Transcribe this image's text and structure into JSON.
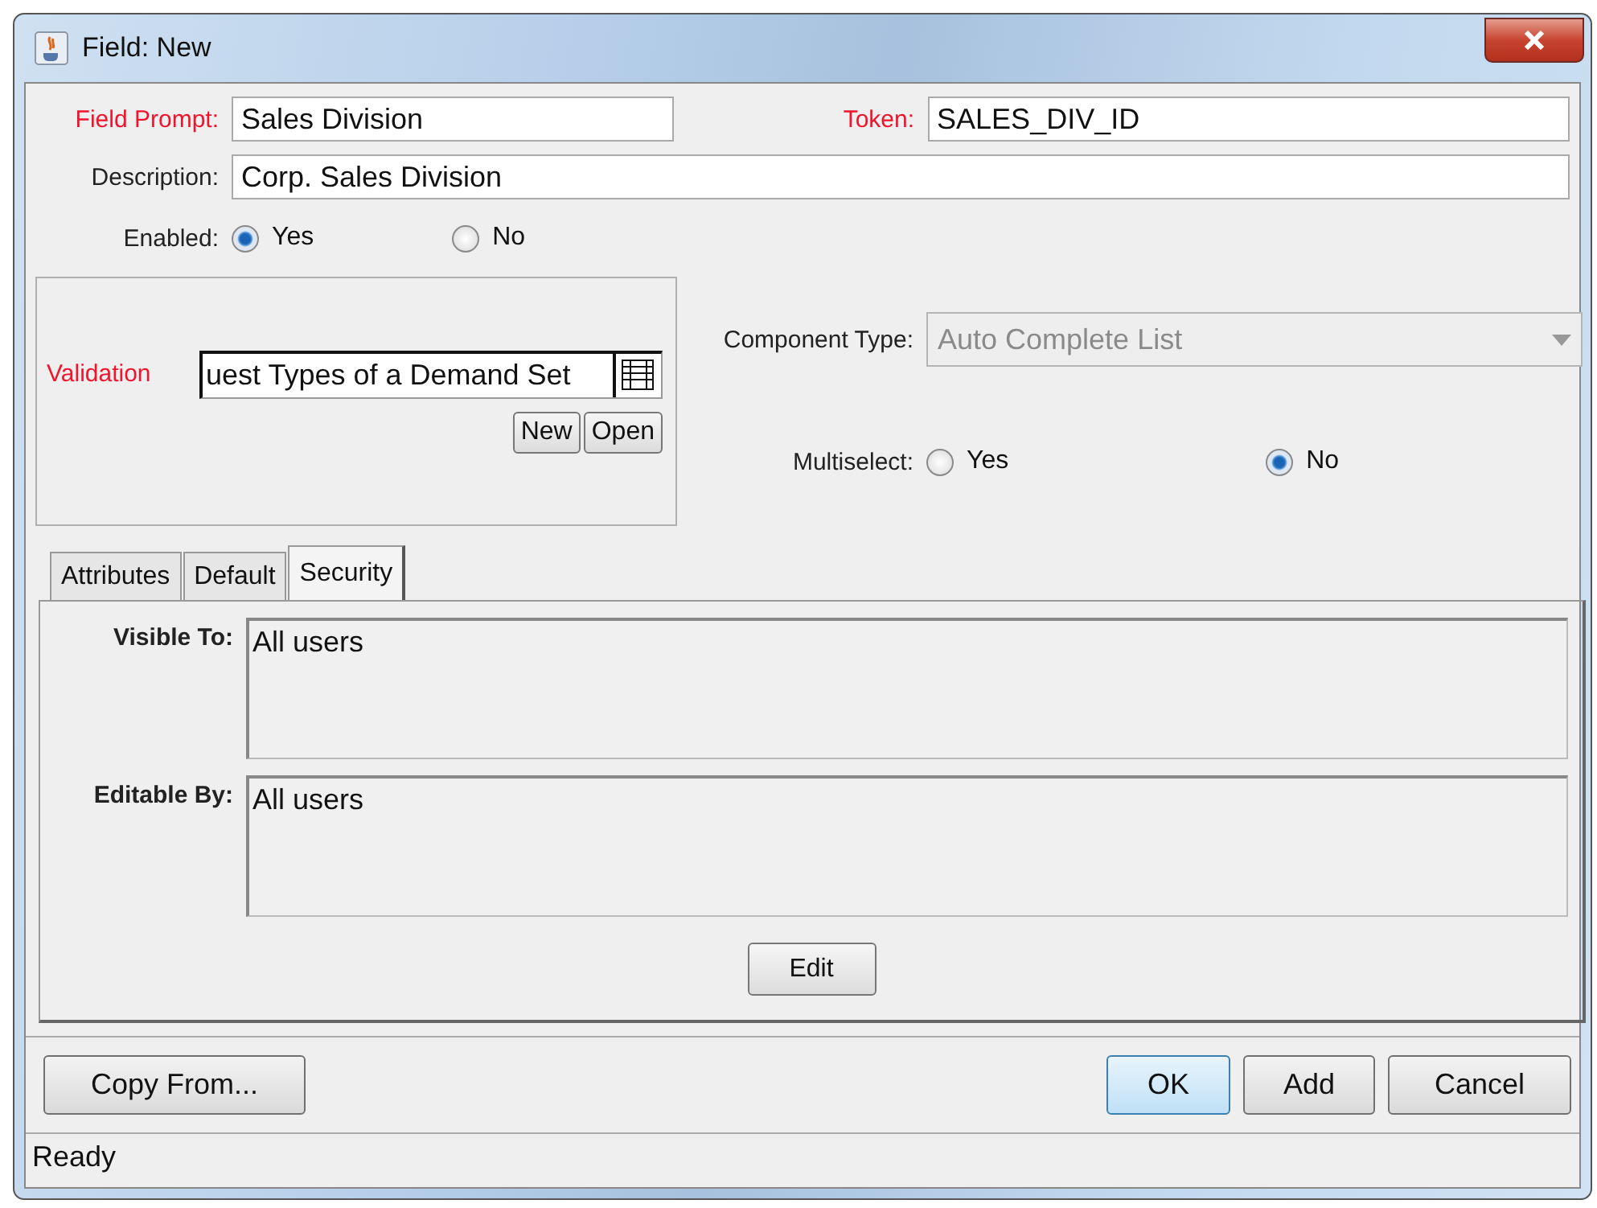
{
  "window": {
    "title": "Field: New"
  },
  "field_prompt": {
    "label": "Field Prompt:",
    "value": "Sales Division",
    "required": true
  },
  "token": {
    "label": "Token:",
    "value": "SALES_DIV_ID",
    "required": true
  },
  "description": {
    "label": "Description:",
    "value": "Corp. Sales Division",
    "required": false
  },
  "enabled": {
    "label": "Enabled:",
    "options": [
      {
        "label": "Yes",
        "selected": true
      },
      {
        "label": "No",
        "selected": false
      }
    ]
  },
  "validation": {
    "label": "Validation",
    "value": "uest Types of a Demand Set",
    "required": true,
    "buttons": [
      "New",
      "Open"
    ]
  },
  "component_type": {
    "label": "Component Type:",
    "value": "Auto Complete List",
    "disabled": true
  },
  "multiselect": {
    "label": "Multiselect:",
    "options": [
      {
        "label": "Yes",
        "selected": false
      },
      {
        "label": "No",
        "selected": true
      }
    ]
  },
  "tabs": [
    {
      "label": "Attributes",
      "selected": false
    },
    {
      "label": "Default",
      "selected": false
    },
    {
      "label": "Security",
      "selected": true
    }
  ],
  "security": {
    "fields": [
      {
        "label": "Visible To:",
        "value": "All users"
      },
      {
        "label": "Editable By:",
        "value": "All users"
      }
    ],
    "edit_button": "Edit"
  },
  "buttons": {
    "left": "Copy From...",
    "right": [
      {
        "label": "OK",
        "default": true
      },
      {
        "label": "Add",
        "default": false
      },
      {
        "label": "Cancel",
        "default": false
      }
    ]
  },
  "status_bar": "Ready"
}
